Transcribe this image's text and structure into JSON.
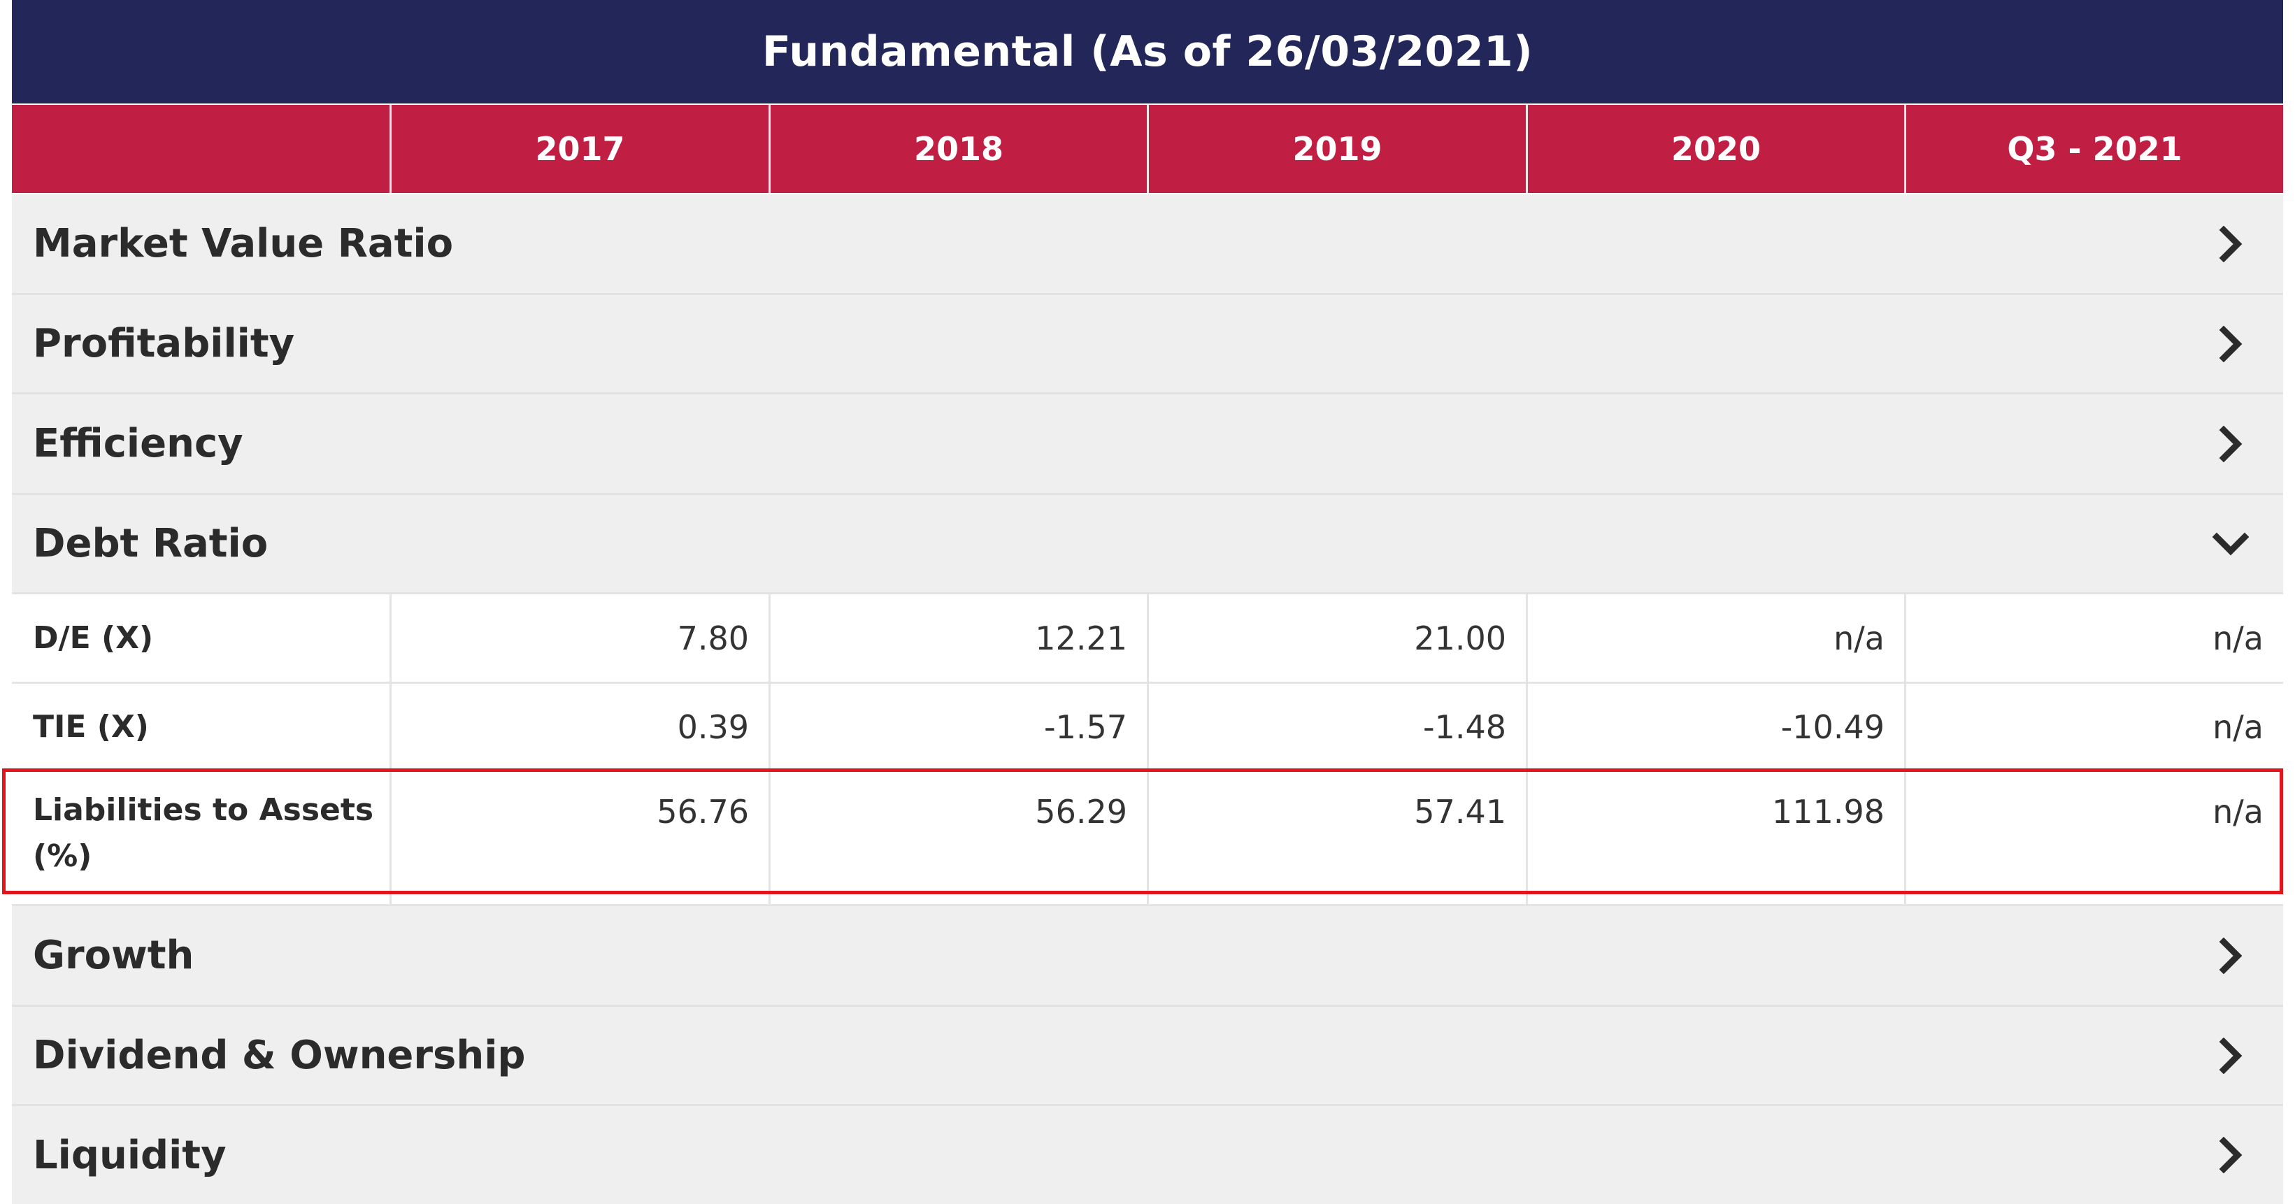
{
  "title": "Fundamental (As of 26/03/2021)",
  "columns": [
    "",
    "2017",
    "2018",
    "2019",
    "2020",
    "Q3 - 2021"
  ],
  "sections": {
    "market_value": "Market Value Ratio",
    "profitability": "Profitability",
    "efficiency": "Efficiency",
    "debt_ratio": "Debt Ratio",
    "growth": "Growth",
    "dividend": "Dividend & Ownership",
    "liquidity": "Liquidity"
  },
  "debt_rows": [
    {
      "label": "D/E (X)",
      "values": [
        "7.80",
        "12.21",
        "21.00",
        "n/a",
        "n/a"
      ]
    },
    {
      "label": "TIE (X)",
      "values": [
        "0.39",
        "-1.57",
        "-1.48",
        "-10.49",
        "n/a"
      ]
    },
    {
      "label": "Liabilities to Assets (%)",
      "values": [
        "56.76",
        "56.29",
        "57.41",
        "111.98",
        "n/a"
      ]
    }
  ],
  "icons": {
    "collapsed": "chevron-right-icon",
    "expanded": "chevron-down-icon"
  },
  "colors": {
    "title_bg": "#232659",
    "header_bg": "#c11e43",
    "section_bg": "#efefef",
    "highlight": "#e0161c"
  }
}
